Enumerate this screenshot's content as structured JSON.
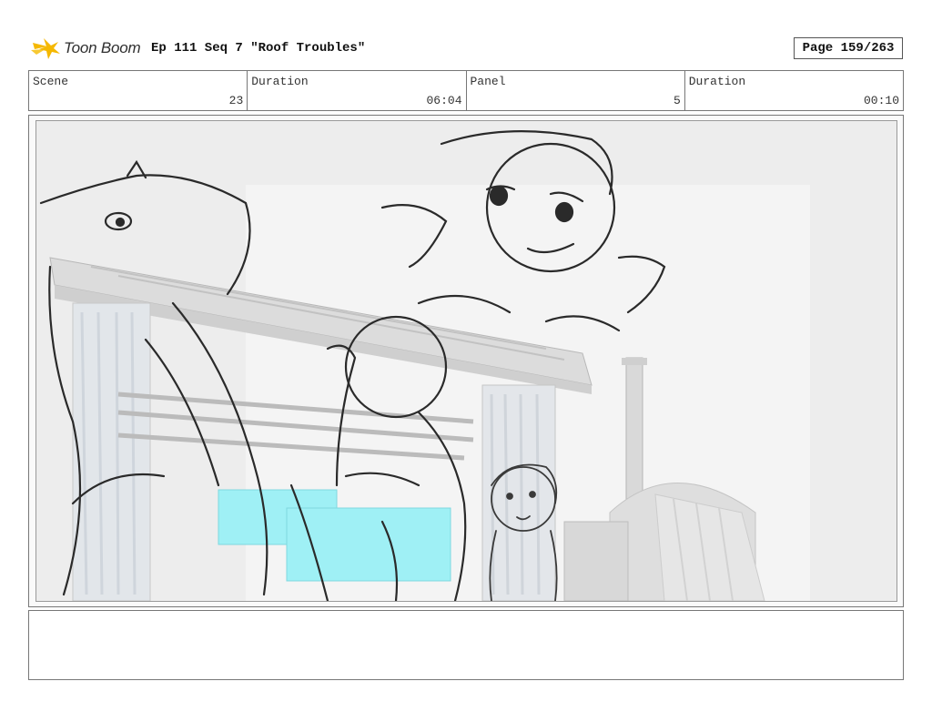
{
  "header": {
    "logo_text": "Toon Boom",
    "episode_title": "Ep 111 Seq 7 \"Roof Troubles\"",
    "page_label": "Page 159/263"
  },
  "info": {
    "scene_label": "Scene",
    "scene_value": "23",
    "duration_label": "Duration",
    "duration_value": "06:04",
    "panel_label": "Panel",
    "panel_value": "5",
    "panel_duration_label": "Duration",
    "panel_duration_value": "00:10"
  },
  "notes": {
    "text": ""
  },
  "colors": {
    "logo_yellow": "#f5b800",
    "highlight_cyan": "#9ff0f5",
    "border": "#777777"
  }
}
